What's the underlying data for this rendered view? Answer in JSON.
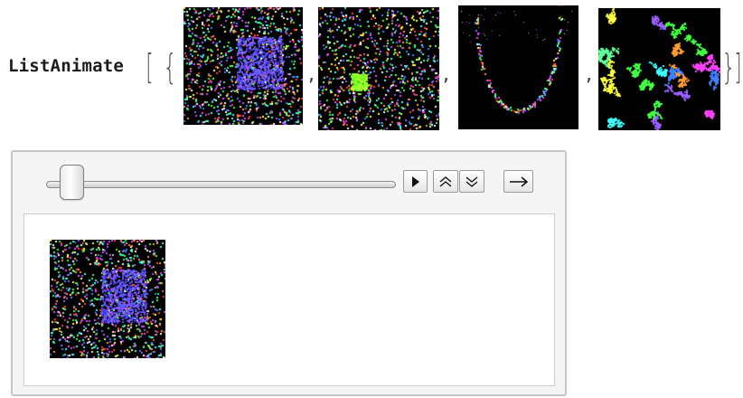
{
  "input": {
    "function_name": "ListAnimate",
    "open_bracket": "[",
    "open_brace": "{",
    "close_brace": "}",
    "close_bracket": "]",
    "separator": ","
  },
  "thumbnails": [
    {
      "name": "frame-1-noise-square"
    },
    {
      "name": "frame-2-green-square"
    },
    {
      "name": "frame-3-dark-curve"
    },
    {
      "name": "frame-4-color-worms"
    }
  ],
  "animator": {
    "slider_frame_index": 1,
    "slider_frame_count": 4,
    "controls": [
      {
        "id": "play",
        "icon": "play-icon"
      },
      {
        "id": "faster",
        "icon": "double-chevron-up-icon"
      },
      {
        "id": "slower",
        "icon": "double-chevron-down-icon"
      },
      {
        "id": "direction",
        "icon": "arrow-right-icon"
      }
    ],
    "current_frame": "frame-1-noise-square"
  },
  "colors": {
    "panel_background": "#f5f5f5",
    "panel_border": "#c6c6c6",
    "frame_background": "#000000"
  }
}
